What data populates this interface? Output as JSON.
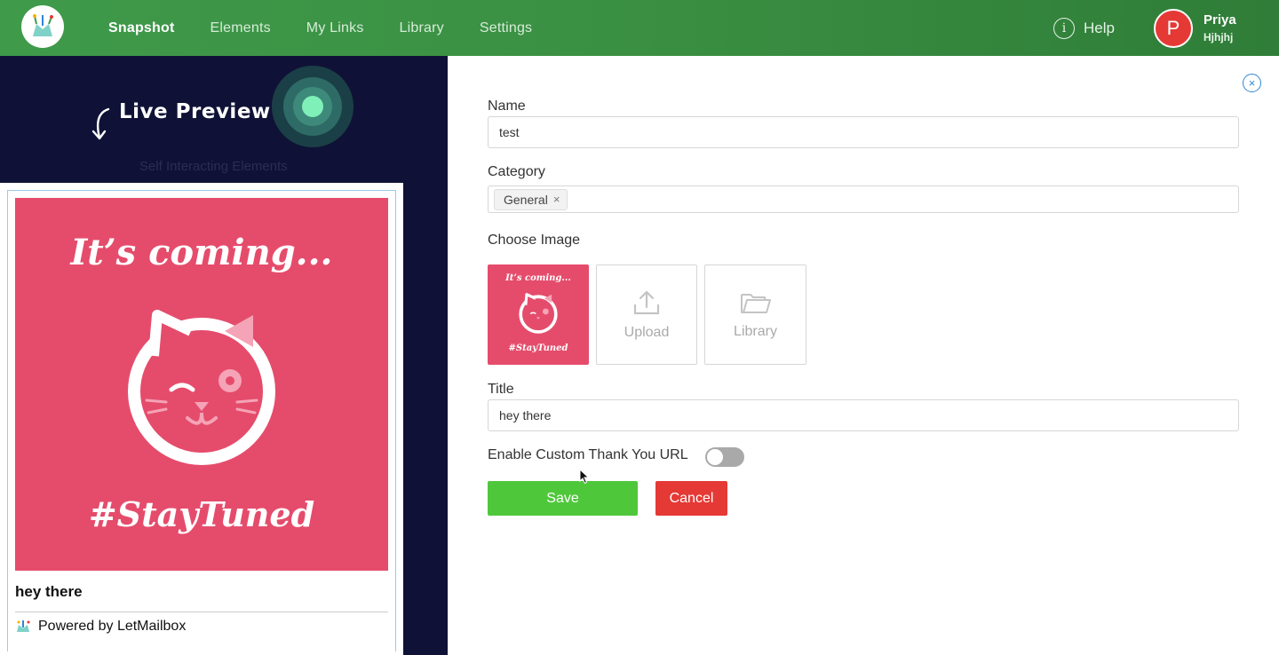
{
  "nav": {
    "items": [
      "Snapshot",
      "Elements",
      "My Links",
      "Library",
      "Settings"
    ],
    "active": "Snapshot",
    "help_label": "Help",
    "user_initial": "P",
    "user_name": "Priya",
    "user_sub": "Hjhjhj"
  },
  "preview": {
    "live_label": "Live Preview",
    "faint_text": "Self Interacting Elements",
    "image_headline": "It’s coming...",
    "image_tag": "#StayTuned",
    "title": "hey there",
    "powered_by": "Powered by LetMailbox"
  },
  "form": {
    "name_label": "Name",
    "name_value": "test",
    "category_label": "Category",
    "category_chip": "General",
    "chip_remove": "×",
    "image_label": "Choose Image",
    "upload_label": "Upload",
    "library_label": "Library",
    "title_label": "Title",
    "title_value": "hey there",
    "custom_url_label": "Enable Custom Thank You URL",
    "custom_url_enabled": false,
    "save_label": "Save",
    "cancel_label": "Cancel",
    "close_glyph": "×"
  },
  "colors": {
    "nav_green": "#3a8f42",
    "preview_bg": "#0f1236",
    "image_pink": "#e54c6c",
    "save_green": "#4fc73a",
    "cancel_red": "#e53935",
    "close_blue": "#2f86d6"
  },
  "icons": [
    "logo-icon",
    "help-icon",
    "arrow-icon",
    "cat-icon",
    "upload-icon",
    "folder-icon",
    "close-icon",
    "cursor-icon",
    "mailbox-icon"
  ]
}
